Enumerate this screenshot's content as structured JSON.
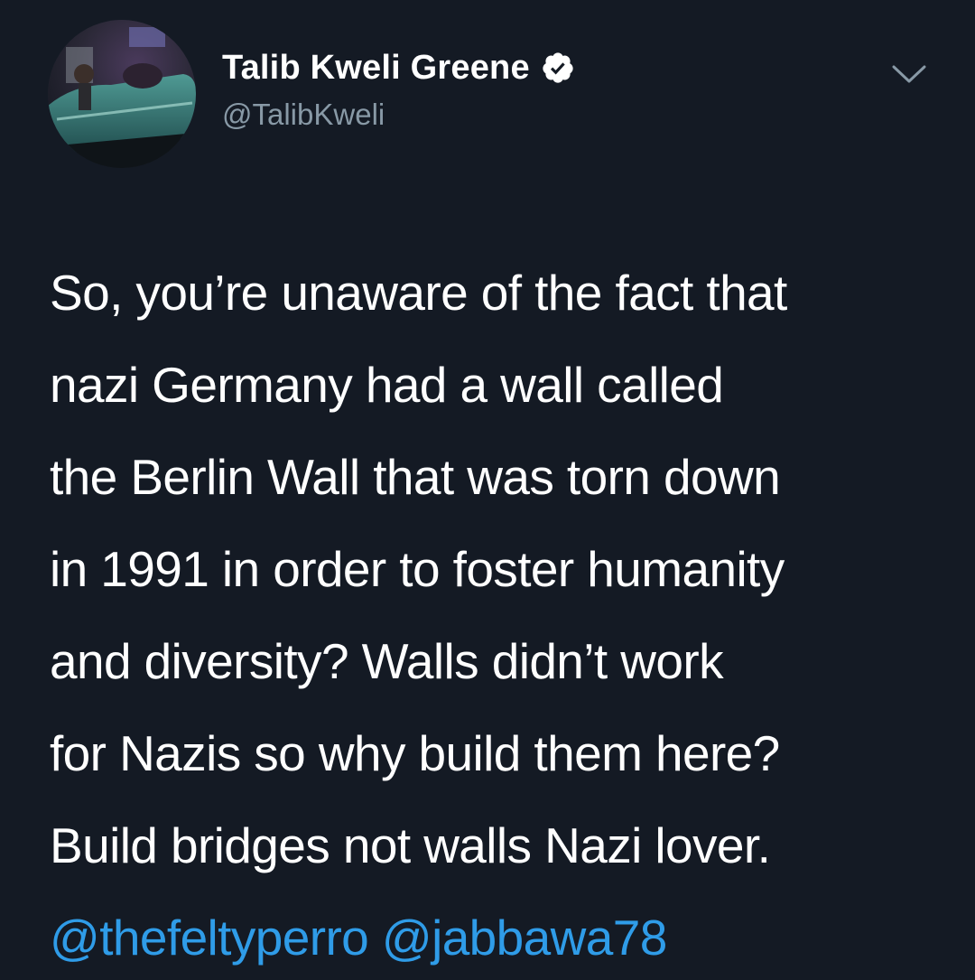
{
  "author": {
    "display_name": "Talib Kweli Greene",
    "handle": "@TalibKweli",
    "verified": true,
    "avatar_icon": "profile-photo-car",
    "verified_icon": "verified-badge-icon",
    "menu_icon": "chevron-down-icon"
  },
  "tweet": {
    "lines": [
      "So, you’re unaware of the fact that",
      "nazi Germany had a wall called",
      "the Berlin Wall that was torn down",
      "in 1991 in order to foster humanity",
      "and diversity? Walls didn’t work",
      "for Nazis so why build them here?",
      "Build bridges not walls Nazi lover."
    ],
    "mentions": [
      "@thefeltyperro",
      "@jabbawa78"
    ]
  },
  "colors": {
    "background": "#141a24",
    "text": "#ffffff",
    "handle": "#8899a6",
    "mention": "#2f9ce8",
    "verified_badge": "#ffffff"
  }
}
